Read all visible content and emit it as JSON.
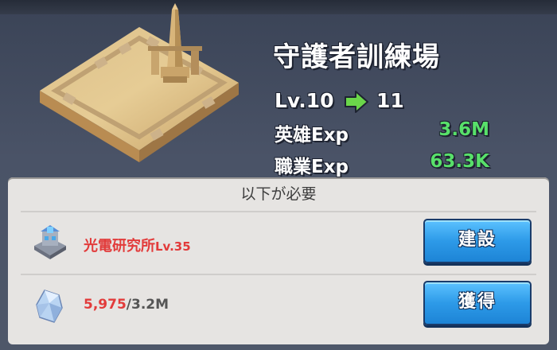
{
  "building": {
    "title": "守護者訓練場",
    "level_from": "Lv.10",
    "level_to": "11",
    "hero_exp_label": "英雄Exp",
    "hero_exp_value": "3.6M",
    "job_exp_label": "職業Exp",
    "job_exp_value": "63.3K"
  },
  "requirements": {
    "header": "以下が必要",
    "building_req": {
      "name": "光電研究所",
      "level": "Lv.35",
      "button_label": "建設"
    },
    "resource_req": {
      "have": "5,975",
      "need": "/3.2M",
      "button_label": "獲得"
    }
  },
  "colors": {
    "accent_green": "#58e06a",
    "warning_red": "#e23b3b",
    "button_blue": "#2d9ae8"
  },
  "icons": {
    "arrow": "green-right-arrow-icon",
    "building": "lab-building-icon",
    "resource": "crystal-icon"
  }
}
